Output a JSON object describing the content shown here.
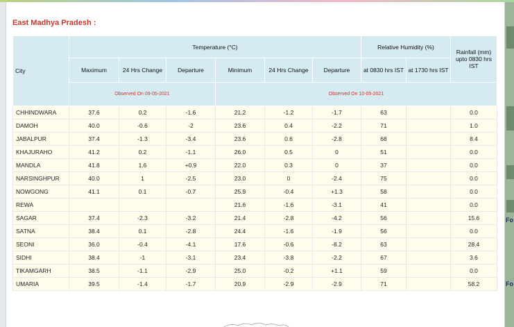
{
  "region": "East Madhya Pradesh :",
  "headers": {
    "city": "City",
    "temperature": "Temperature (°C)",
    "humidity": "Relative Humidity (%)",
    "rainfall": "Rainfall (mm) upto 0830 hrs IST",
    "maximum": "Maximum",
    "change1": "24 Hrs Change",
    "departure1": "Departure",
    "minimum": "Minimum",
    "change2": "24 Hrs Change",
    "departure2": "Departure",
    "rh0830": "at 0830 hrs IST",
    "rh1730": "at 1730 hrs IST",
    "observed1": "Observed On 09-05-2021",
    "observed2": "Observed On 10-05-2021"
  },
  "rows": [
    [
      "CHHINDWARA",
      "37.6",
      "0.2",
      "-1.6",
      "21.2",
      "-1.2",
      "-1.7",
      "63",
      "",
      "0.0"
    ],
    [
      "DAMOH",
      "40.0",
      "-0.6",
      "-2",
      "23.6",
      "0.4",
      "-2.2",
      "71",
      "",
      "1.0"
    ],
    [
      "JABALPUR",
      "37.4",
      "-1.3",
      "-3.4",
      "23.6",
      "0.6",
      "-2.8",
      "68",
      "",
      "8.4"
    ],
    [
      "KHAJURAHO",
      "41.2",
      "0.2",
      "-1.1",
      "26.0",
      "0.5",
      "0",
      "51",
      "",
      "0.0"
    ],
    [
      "MANDLA",
      "41.8",
      "1.6",
      "+0.9",
      "22.0",
      "0.3",
      "0",
      "37",
      "",
      "0.0"
    ],
    [
      "NARSINGHPUR",
      "40.0",
      "1",
      "-2.5",
      "23.0",
      "0",
      "-2.4",
      "75",
      "",
      "0.0"
    ],
    [
      "NOWGONG",
      "41.1",
      "0.1",
      "-0.7",
      "25.9",
      "-0.4",
      "+1.3",
      "58",
      "",
      "0.0"
    ],
    [
      "REWA",
      "",
      "",
      "",
      "21.6",
      "-1.6",
      "-3.1",
      "41",
      "",
      "0.0"
    ],
    [
      "SAGAR",
      "37.4",
      "-2.3",
      "-3.2",
      "21.4",
      "-2.8",
      "-4.2",
      "56",
      "",
      "15.6"
    ],
    [
      "SATNA",
      "38.4",
      "0.1",
      "-2.8",
      "24.4",
      "-1.6",
      "-1.9",
      "56",
      "",
      "0.0"
    ],
    [
      "SEONI",
      "36.0",
      "-0.4",
      "-4.1",
      "17.6",
      "-0.6",
      "-8.2",
      "63",
      "",
      "28.4"
    ],
    [
      "SIDHI",
      "38.4",
      "-1",
      "-3.1",
      "23.4",
      "-3.8",
      "-2.2",
      "67",
      "",
      "3.6"
    ],
    [
      "TIKAMGARH",
      "38.5",
      "-1.1",
      "-2.9",
      "25.0",
      "-0.2",
      "+1.1",
      "59",
      "",
      "0.0"
    ],
    [
      "UMARIA",
      "39.5",
      "-1.4",
      "-1.7",
      "20.9",
      "-2.9",
      "-2.9",
      "71",
      "",
      "58.2"
    ]
  ],
  "side_text": [
    "Fo",
    "Fo"
  ]
}
